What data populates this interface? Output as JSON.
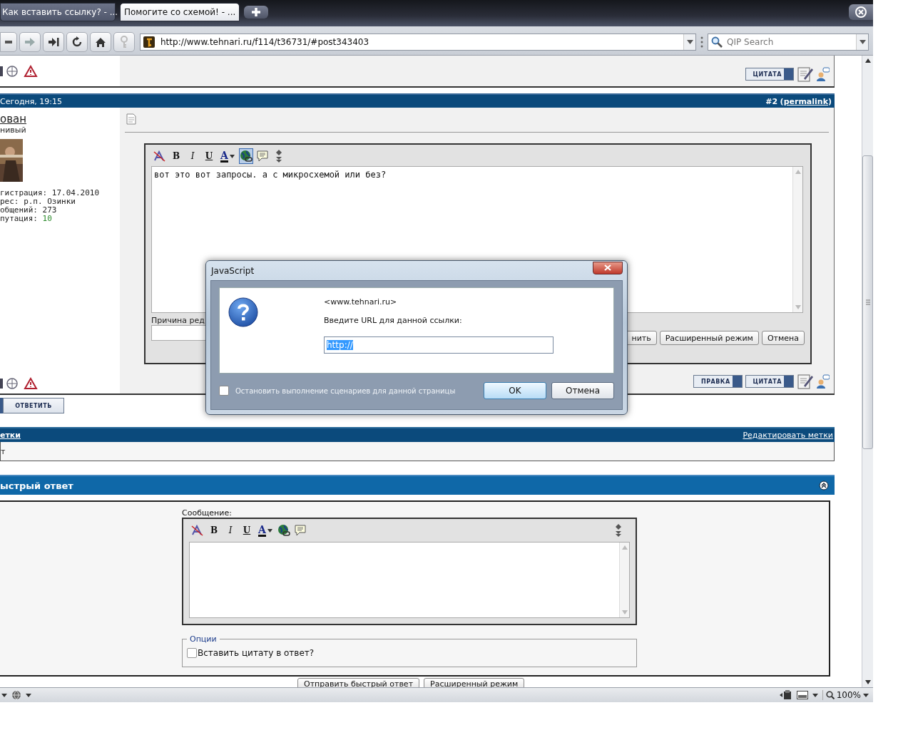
{
  "browser": {
    "tabs": [
      {
        "title": "Как вставить ссылку? - ...",
        "selected": false
      },
      {
        "title": "Помогите со схемой! - ...",
        "selected": true
      }
    ],
    "address": "http://www.tehnari.ru/f114/t36731/#post343403",
    "search": {
      "placeholder": "QIP Search"
    },
    "zoom": "100%"
  },
  "top_post": {
    "buttons": [
      "ЦИТАТА"
    ]
  },
  "post": {
    "date": "Сегодня, 19:15",
    "number": "#2",
    "permalink": "permalink",
    "paren_open": "(",
    "paren_close": ")",
    "author": "ован",
    "rank": "нивый",
    "stats": [
      {
        "label": "гистрация:",
        "value": "17.04.2010",
        "kind": "plain"
      },
      {
        "label": "рес:",
        "value": "р.п. Озинки",
        "kind": "plain"
      },
      {
        "label": "общений:",
        "value": "273",
        "kind": "plain"
      },
      {
        "label": "путация:",
        "value": "10",
        "kind": "reputation"
      }
    ],
    "editor": {
      "toolbar": [
        {
          "kind": "clear",
          "active": false
        },
        {
          "kind": "bold",
          "label": "B",
          "active": false
        },
        {
          "kind": "italic",
          "label": "I",
          "active": false
        },
        {
          "kind": "underline",
          "label": "U",
          "active": false
        },
        {
          "kind": "color",
          "label": "A",
          "active": false
        },
        {
          "kind": "link",
          "active": true
        },
        {
          "kind": "quote",
          "active": false
        },
        {
          "kind": "resize",
          "active": false
        }
      ],
      "text": "вот это вот запросы. а с микросхемой или без?",
      "reason_label": "Причина ред",
      "buttons": [
        "нить",
        "Расширенный режим",
        "Отмена"
      ]
    },
    "footer_buttons": [
      "ПРАВКА",
      "ЦИТАТА"
    ]
  },
  "reply_button": "ОТВЕТИТЬ",
  "tags": {
    "title": "етки",
    "edit_link": "Редактировать метки",
    "content": "т"
  },
  "quick_reply": {
    "title": "ыстрый ответ",
    "message_label": "Сообщение:",
    "toolbar": [
      {
        "kind": "clear",
        "active": false
      },
      {
        "kind": "bold",
        "label": "B",
        "active": false
      },
      {
        "kind": "italic",
        "label": "I",
        "active": false
      },
      {
        "kind": "underline",
        "label": "U",
        "active": false
      },
      {
        "kind": "color",
        "label": "A",
        "active": false
      },
      {
        "kind": "link",
        "active": false
      },
      {
        "kind": "quote",
        "active": false
      },
      {
        "kind": "resize",
        "active": false
      }
    ],
    "options_legend": "Опции",
    "quote_option": {
      "label": "Вставить цитату в ответ?",
      "checked": false
    },
    "buttons": [
      "Отправить быстрый ответ",
      "Расширенный режим"
    ]
  },
  "dialog": {
    "title": "JavaScript",
    "origin": "<www.tehnari.ru>",
    "prompt": "Введите URL для данной ссылки:",
    "value": "http://",
    "stop_scripts": {
      "label": "Остановить выполнение сценариев для данной страницы",
      "checked": false
    },
    "buttons": [
      {
        "label": "OK",
        "selected": true
      },
      {
        "label": "Отмена",
        "selected": false
      }
    ]
  }
}
